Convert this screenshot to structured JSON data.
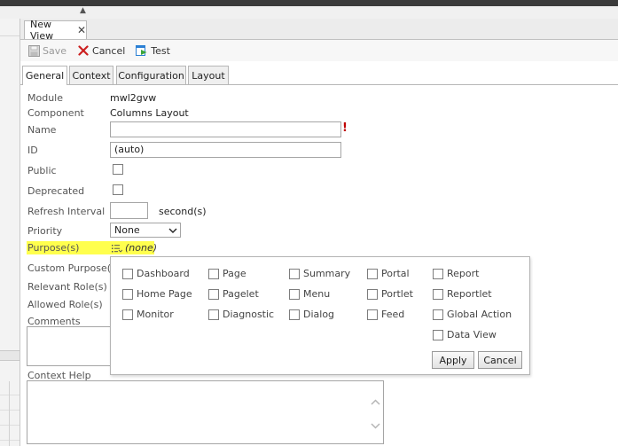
{
  "window": {
    "doc_tab_title": "New View",
    "toolbar": {
      "save": "Save",
      "cancel": "Cancel",
      "test": "Test"
    }
  },
  "subtabs": [
    "General",
    "Context",
    "Configuration",
    "Layout"
  ],
  "form": {
    "module_label": "Module",
    "module_value": "mwl2gvw",
    "component_label": "Component",
    "component_value": "Columns Layout",
    "name_label": "Name",
    "name_value": "",
    "required_marker": "!",
    "id_label": "ID",
    "id_value": "(auto)",
    "public_label": "Public",
    "deprecated_label": "Deprecated",
    "refresh_label": "Refresh Interval",
    "refresh_value": "",
    "refresh_unit": "second(s)",
    "priority_label": "Priority",
    "priority_value": "None",
    "purposes_label": "Purpose(s)",
    "purposes_value": "(none)",
    "custom_purpose_label": "Custom Purpose(s)",
    "relevant_roles_label": "Relevant Role(s)",
    "allowed_roles_label": "Allowed Role(s)",
    "comments_label": "Comments",
    "context_help_label": "Context Help"
  },
  "purpose_popup": {
    "options": [
      [
        "Dashboard",
        "Page",
        "Summary",
        "Portal",
        "Report"
      ],
      [
        "Home Page",
        "Pagelet",
        "Menu",
        "Portlet",
        "Reportlet"
      ],
      [
        "Monitor",
        "Diagnostic",
        "Dialog",
        "Feed",
        "Global Action"
      ],
      [
        "",
        "",
        "",
        "",
        "Data View"
      ]
    ],
    "apply": "Apply",
    "cancel": "Cancel"
  },
  "colors": {
    "highlight": "#ffff4d",
    "required": "#c00000",
    "cancel_icon": "#cc1f1f",
    "test_icon": "#2a7fd4"
  },
  "icons": [
    "save-icon",
    "cancel-x-icon",
    "test-icon",
    "close-icon",
    "list-picker-icon",
    "chevron-down-icon",
    "scroll-up-icon",
    "scroll-down-icon"
  ]
}
